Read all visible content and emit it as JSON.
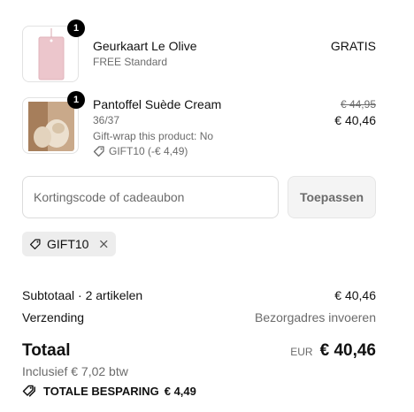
{
  "items": [
    {
      "name": "Geurkaart Le Olive",
      "variant": "FREE Standard",
      "quantity": "1",
      "price": "GRATIS"
    },
    {
      "name": "Pantoffel Suède Cream",
      "variant": "36/37",
      "note": "Gift-wrap this product: No",
      "discount": "GIFT10 (-€ 4,49)",
      "quantity": "1",
      "original_price": "€ 44,95",
      "price": "€ 40,46"
    }
  ],
  "discount_form": {
    "placeholder": "Kortingscode of cadeaubon",
    "apply_label": "Toepassen"
  },
  "applied_code": {
    "code": "GIFT10"
  },
  "summary": {
    "subtotal_label": "Subtotaal · 2 artikelen",
    "subtotal_value": "€ 40,46",
    "shipping_label": "Verzending",
    "shipping_value": "Bezorgadres invoeren",
    "total_label": "Totaal",
    "currency": "EUR",
    "total_value": "€ 40,46",
    "tax_note": "Inclusief € 7,02 btw",
    "savings_label": "TOTALE BESPARING",
    "savings_value": "€ 4,49"
  },
  "icons": {
    "tag": "tag-icon",
    "close": "close-icon",
    "savings": "price-tags-icon"
  }
}
